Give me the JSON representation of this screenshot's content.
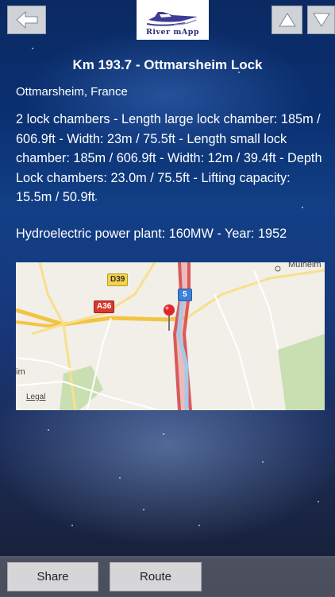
{
  "header": {
    "logo_text": "River mApp",
    "back_icon": "arrow-left-icon",
    "up_icon": "triangle-up-icon",
    "down_icon": "triangle-down-icon"
  },
  "detail": {
    "title": "Km 193.7 - Ottmarsheim Lock",
    "location": "Ottmarsheim, France",
    "description": "2 lock chambers - Length large lock chamber: 185m / 606.9ft - Width: 23m / 75.5ft - Length small lock chamber: 185m / 606.9ft - Width: 12m / 39.4ft - Depth Lock chambers: 23.0m / 75.5ft - Lifting capacity: 15.5m / 50.9ft",
    "power": "Hydroelectric power plant: 160MW - Year: 1952"
  },
  "map": {
    "road_d39": "D39",
    "road_a36": "A36",
    "road_5": "5",
    "place_mulheim": "Mulheim",
    "place_im": "im",
    "legal": "Legal",
    "pin_icon": "map-pin-icon"
  },
  "actions": {
    "share": "Share",
    "route": "Route"
  }
}
